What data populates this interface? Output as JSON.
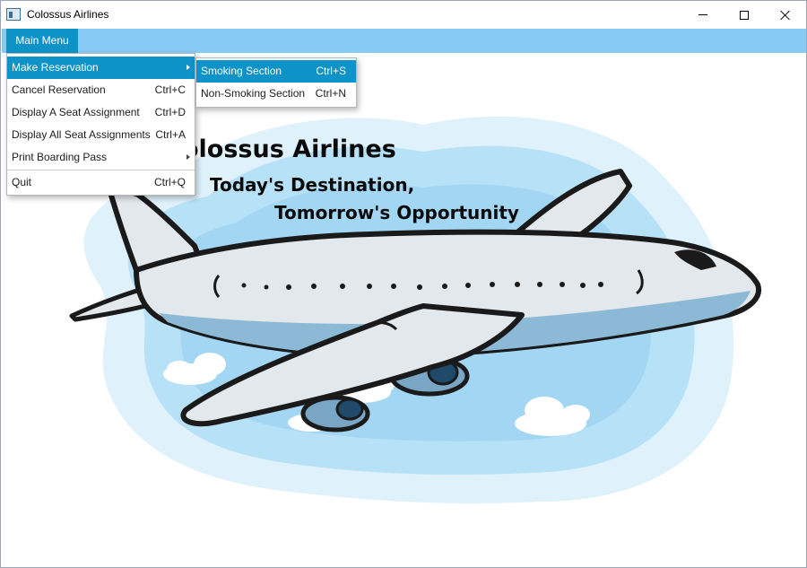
{
  "window": {
    "title": "Colossus Airlines",
    "app_icon": "window-app-icon",
    "controls": [
      "minimize-icon",
      "maximize-icon",
      "close-icon"
    ]
  },
  "menubar": {
    "items": [
      {
        "label": "Main Menu"
      }
    ]
  },
  "main_menu": {
    "items": [
      {
        "label": "Make Reservation",
        "shortcut": "",
        "has_submenu": true
      },
      {
        "label": "Cancel Reservation",
        "shortcut": "Ctrl+C"
      },
      {
        "label": "Display A Seat Assignment",
        "shortcut": "Ctrl+D"
      },
      {
        "label": "Display All Seat Assignments",
        "shortcut": "Ctrl+A"
      },
      {
        "label": "Print Boarding Pass",
        "shortcut": "",
        "has_submenu": true
      },
      {
        "label": "Quit",
        "shortcut": "Ctrl+Q"
      }
    ]
  },
  "submenu": {
    "items": [
      {
        "label": "Smoking Section",
        "shortcut": "Ctrl+S"
      },
      {
        "label": "Non-Smoking Section",
        "shortcut": "Ctrl+N"
      }
    ]
  },
  "banner": {
    "title": "olossus Airlines",
    "tagline_1": "Today's Destination,",
    "tagline_2": "Tomorrow's Opportunity"
  },
  "colors": {
    "menubar_bg": "#87cbf5",
    "selection_bg": "#0e93c8",
    "sky_outer": "#dff1fb",
    "sky_mid": "#b7e1f7",
    "sky_inner": "#8ccbee",
    "plane_body": "#e3e8ed",
    "plane_belly": "#8cbad6",
    "outline": "#1a1a1a"
  }
}
